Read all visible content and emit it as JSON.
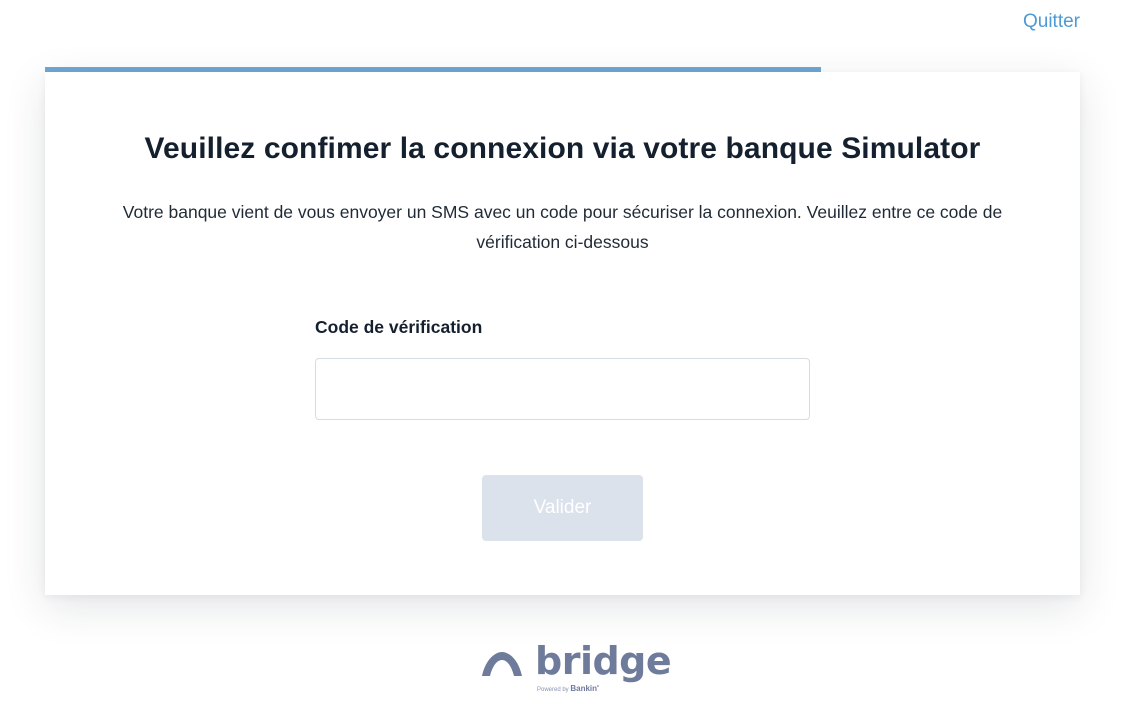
{
  "header": {
    "quit_label": "Quitter"
  },
  "progress": {
    "fraction": 0.75,
    "color": "#6fa9d4"
  },
  "card": {
    "title": "Veuillez confimer la connexion via votre banque Simulator",
    "description": "Votre banque vient de vous envoyer un SMS avec un code pour sécuriser la connexion. Veuillez entre ce code de vérification ci-dessous",
    "field": {
      "label": "Code de vérification",
      "value": "",
      "placeholder": ""
    },
    "submit_label": "Valider"
  },
  "footer": {
    "brand_icon": "bridge-arc-icon",
    "brand_name": "bridge",
    "powered_by_prefix": "Powered by",
    "powered_by_name": "Bankin'"
  },
  "colors": {
    "accent": "#4d9ad4",
    "button_disabled": "#dbe2ec",
    "brand": "#6f7b9a"
  }
}
